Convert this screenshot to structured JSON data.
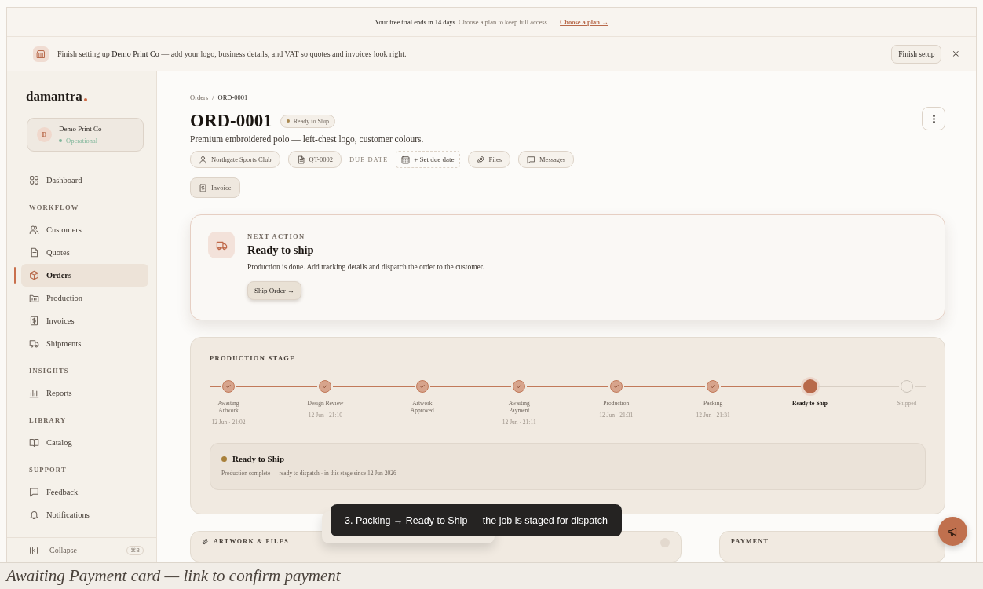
{
  "trial_banner": {
    "text": "**Your free trial ends in 14 days.** Choose a plan to keep full access.",
    "link": "Choose a plan →"
  },
  "setup_banner": {
    "text": "Finish setting up **Demo Print Co** — add your logo, business details, and VAT so quotes and invoices look right.",
    "button": "Finish setup",
    "close": "×"
  },
  "sidebar": {
    "logo": "damantra",
    "org": {
      "initial": "D",
      "name": "Demo Print Co",
      "status": "Operational"
    },
    "sections": [
      {
        "items": [
          {
            "label": "Dashboard",
            "selected": false
          }
        ]
      },
      {
        "heading": "WORKFLOW",
        "items": [
          {
            "label": "Customers",
            "selected": false
          },
          {
            "label": "Quotes",
            "selected": false
          },
          {
            "label": "Orders",
            "selected": true
          },
          {
            "label": "Production",
            "selected": false
          },
          {
            "label": "Invoices",
            "selected": false
          },
          {
            "label": "Shipments",
            "selected": false
          }
        ]
      },
      {
        "heading": "INSIGHTS",
        "items": [
          {
            "label": "Reports",
            "selected": false
          }
        ]
      },
      {
        "heading": "LIBRARY",
        "items": [
          {
            "label": "Catalog",
            "selected": false
          }
        ]
      },
      {
        "heading": "SUPPORT",
        "items": [
          {
            "label": "Feedback",
            "selected": false
          },
          {
            "label": "Notifications",
            "selected": false
          }
        ]
      }
    ],
    "collapse": {
      "label": "Collapse",
      "shortcut": "⌘B"
    }
  },
  "order": {
    "breadcrumb": [
      "Orders",
      "ORD-0001"
    ],
    "breadcrumb_separator": "/",
    "title": "ORD-0001",
    "status": {
      "label": "Ready to Ship",
      "color": "#a8874f"
    },
    "subtitle": "Premium embroidered polo — left-chest logo, customer colours.",
    "chips": [
      {
        "kind": "chip",
        "label": "Northgate Sports Club"
      },
      {
        "kind": "chip",
        "label": "QT-0002"
      },
      {
        "kind": "label",
        "label": "DUE DATE"
      },
      {
        "kind": "dashed",
        "label": "+ Set due date"
      },
      {
        "kind": "chip",
        "label": "Files"
      },
      {
        "kind": "chip",
        "label": "Messages"
      },
      {
        "kind": "tinted",
        "label": "Invoice"
      }
    ]
  },
  "next_action": {
    "eyebrow": "NEXT ACTION",
    "title": "Ready to ship",
    "text": "Production is done. Add tracking details and dispatch the order to the customer.",
    "button": "Ship Order →"
  },
  "production": {
    "heading": "PRODUCTION STAGE",
    "steps": [
      {
        "label": "Awaiting Artwork",
        "time": "12 Jun · 21:02",
        "completed": true,
        "current": false
      },
      {
        "label": "Design Review",
        "time": "12 Jun · 21:10",
        "completed": true,
        "current": false
      },
      {
        "label": "Artwork Approved",
        "completed": true,
        "current": false
      },
      {
        "label": "Awaiting Payment",
        "time": "12 Jun · 21:11",
        "completed": true,
        "current": false
      },
      {
        "label": "Production",
        "time": "12 Jun · 21:31",
        "completed": true,
        "current": false
      },
      {
        "label": "Packing",
        "time": "12 Jun · 21:31",
        "completed": true,
        "current": false
      },
      {
        "label": "Ready to Ship",
        "completed": false,
        "current": true
      },
      {
        "label": "Shipped",
        "completed": false,
        "current": false
      }
    ],
    "current": {
      "title": "Ready to Ship",
      "color": "#a8803a",
      "text": "Production complete — ready to dispatch · in this stage since 12 Jun 2026"
    }
  },
  "cards": [
    {
      "title": "ARTWORK & FILES"
    },
    {
      "title": "PAYMENT"
    }
  ],
  "toast": "3. Packing → Ready to Ship — the job is staged for dispatch",
  "caption": "Awaiting Payment card — link to confirm payment"
}
